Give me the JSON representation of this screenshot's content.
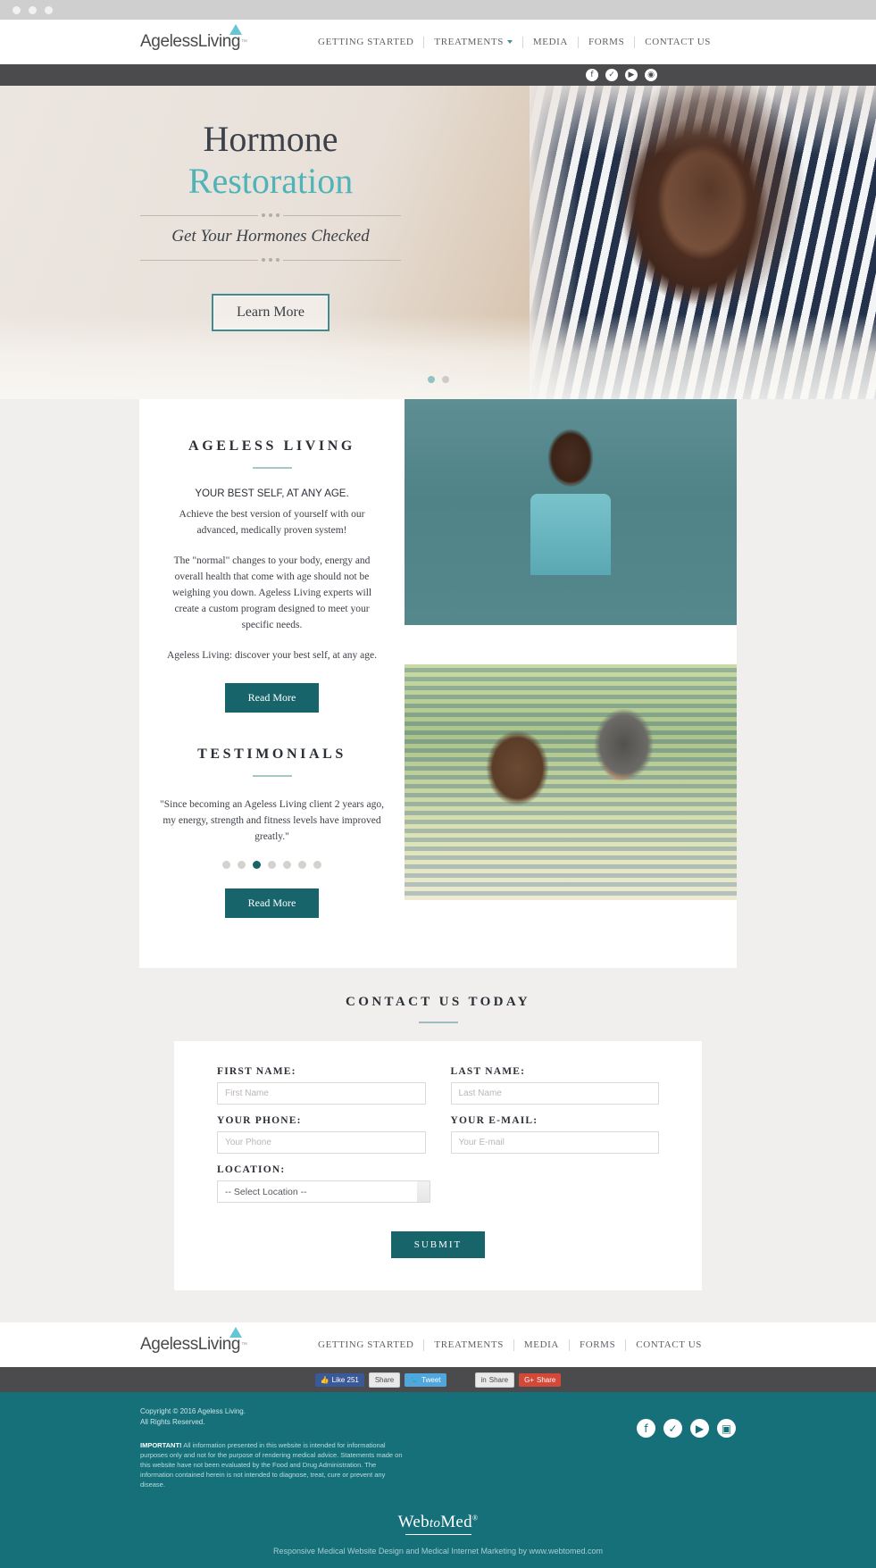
{
  "brand": {
    "name": "AgelessLiving",
    "tm": "™",
    "accent": "#15707a",
    "teal": "#4fb3b8"
  },
  "nav": {
    "items": [
      {
        "label": "Getting Started",
        "caret": false
      },
      {
        "label": "Treatments",
        "caret": true
      },
      {
        "label": "Media",
        "caret": false
      },
      {
        "label": "Forms",
        "caret": false
      },
      {
        "label": "Contact Us",
        "caret": false
      }
    ]
  },
  "social_top": [
    {
      "name": "facebook-icon",
      "glyph": "f"
    },
    {
      "name": "twitter-icon",
      "glyph": "✓"
    },
    {
      "name": "youtube-icon",
      "glyph": "▶"
    },
    {
      "name": "instagram-icon",
      "glyph": "◉"
    }
  ],
  "hero": {
    "line1": "Hormone",
    "line2": "Restoration",
    "subtitle": "Get Your Hormones Checked",
    "cta": "Learn More",
    "dots": 2,
    "active_dot": 0
  },
  "about": {
    "title": "AGELESS LIVING",
    "lead": "YOUR BEST SELF, AT ANY AGE.",
    "p1": "Achieve the best version of yourself with our advanced, medically proven system!",
    "p2": "The \"normal\" changes to your body, energy and overall health that come with age should not be weighing you down. Ageless Living experts will create a custom program designed to meet your specific needs.",
    "p3": "Ageless Living: discover your best self, at any age.",
    "read_more": "Read More"
  },
  "testimonials": {
    "title": "TESTIMONIALS",
    "quote": "\"Since becoming an Ageless Living client 2 years ago, my energy, strength and fitness levels have improved greatly.\"",
    "read_more": "Read More",
    "dots": 7,
    "active_dot": 2
  },
  "contact": {
    "title": "CONTACT US TODAY",
    "fields": {
      "first_name": {
        "label": "FIRST NAME:",
        "placeholder": "First Name",
        "value": ""
      },
      "last_name": {
        "label": "LAST NAME:",
        "placeholder": "Last Name",
        "value": ""
      },
      "phone": {
        "label": "YOUR PHONE:",
        "placeholder": "Your Phone",
        "value": ""
      },
      "email": {
        "label": "YOUR E-MAIL:",
        "placeholder": "Your E-mail",
        "value": ""
      },
      "location": {
        "label": "LOCATION:",
        "selected": "-- Select Location --"
      }
    },
    "submit": "SUBMIT"
  },
  "share": {
    "like": "Like 251",
    "fb_share": "Share",
    "tweet": "Tweet",
    "li_share": "Share",
    "gp_share": "Share"
  },
  "footer": {
    "copyright_line1": "Copyright © 2016 Ageless Living.",
    "copyright_line2": "All Rights Reserved.",
    "important_label": "IMPORTANT!",
    "important_text": " All information presented in this website is intended for informational purposes only and not for the purpose of rendering medical advice. Statements made on this website have not been evaluated by the Food and Drug Administration. The information contained herein is not intended to diagnose, treat, cure or prevent any disease.",
    "social": [
      {
        "name": "facebook-icon",
        "glyph": "f"
      },
      {
        "name": "twitter-icon",
        "glyph": "✓"
      },
      {
        "name": "youtube-icon",
        "glyph": "▶"
      },
      {
        "name": "instagram-icon",
        "glyph": "▣"
      }
    ],
    "agency_pre": "Web",
    "agency_mid": "to",
    "agency_post": "Med",
    "agency_sup": "®",
    "tagline": "Responsive Medical Website Design and Medical Internet Marketing by www.webtomed.com"
  }
}
